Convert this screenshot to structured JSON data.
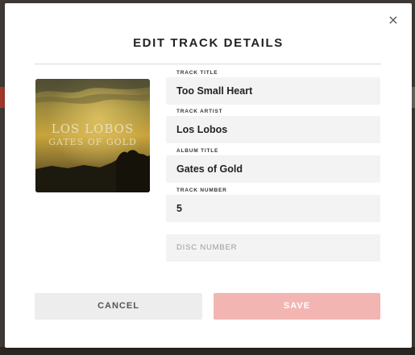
{
  "dialog": {
    "title": "EDIT TRACK DETAILS",
    "close_glyph": "×"
  },
  "album_art": {
    "artist_text": "LOS LOBOS",
    "album_text": "GATES OF GOLD"
  },
  "fields": {
    "track_title": {
      "label": "TRACK TITLE",
      "value": "Too Small Heart"
    },
    "track_artist": {
      "label": "TRACK ARTIST",
      "value": "Los Lobos"
    },
    "album_title": {
      "label": "ALBUM TITLE",
      "value": "Gates of Gold"
    },
    "track_number": {
      "label": "TRACK NUMBER",
      "value": "5"
    },
    "disc_number": {
      "placeholder": "DISC NUMBER"
    }
  },
  "buttons": {
    "cancel": "CANCEL",
    "save": "SAVE"
  },
  "colors": {
    "save_disabled": "#f2b5b2",
    "cancel_bg": "#ededed",
    "field_bg": "#f3f3f3"
  },
  "icons": {
    "close": "close-icon"
  }
}
